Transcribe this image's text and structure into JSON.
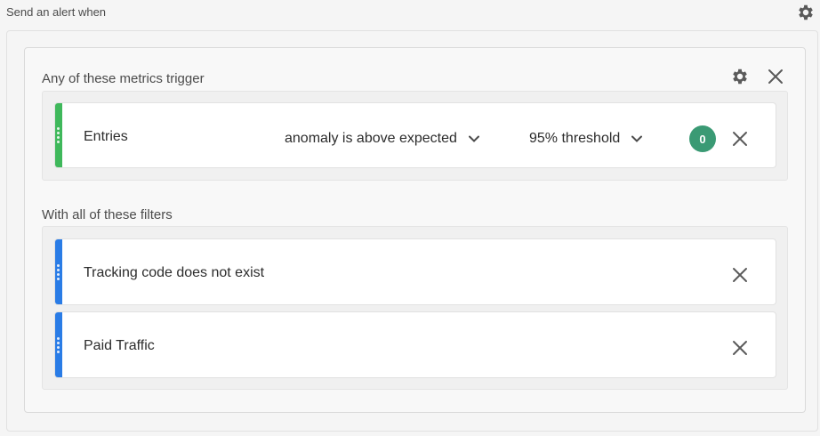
{
  "header": {
    "title": "Send an alert when",
    "settings_icon": "gear-icon"
  },
  "metrics_section": {
    "title": "Any of these metrics trigger",
    "settings_icon": "gear-icon",
    "close_icon": "close-icon",
    "items": [
      {
        "label": "Entries",
        "condition": "anomaly is above expected",
        "threshold": "95% threshold",
        "count": "0",
        "stripe_color": "#3fb85b",
        "badge_color": "#3a9a74"
      }
    ]
  },
  "filters_section": {
    "title": "With all of these filters",
    "items": [
      {
        "label": "Tracking code does not exist",
        "stripe_color": "#2a7ce6"
      },
      {
        "label": "Paid Traffic",
        "stripe_color": "#2a7ce6"
      }
    ]
  },
  "colors": {
    "icon": "#5a5a5a",
    "text": "#2c2c2c",
    "muted_text": "#4b4b4b"
  }
}
